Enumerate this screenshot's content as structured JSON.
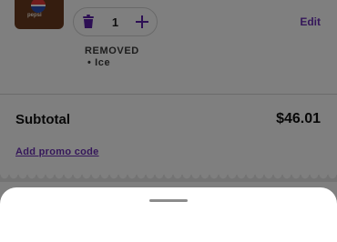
{
  "cart_item": {
    "thumbnail_brand": "pepsi",
    "quantity": "1",
    "edit_label": "Edit",
    "modifications": {
      "title": "REMOVED",
      "items": [
        "• Ice"
      ]
    },
    "icons": {
      "delete": "trash-icon",
      "increment": "plus-icon"
    }
  },
  "summary": {
    "subtotal_label": "Subtotal",
    "subtotal_value": "$46.01",
    "promo_label": "Add promo code"
  },
  "colors": {
    "accent": "#6b2fb5",
    "overlay": "rgba(0,0,0,0.5)",
    "text": "#111111"
  }
}
